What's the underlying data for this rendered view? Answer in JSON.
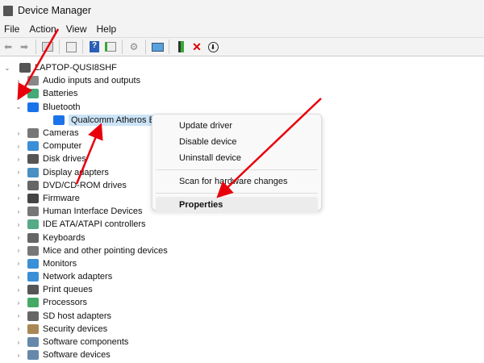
{
  "window": {
    "title": "Device Manager"
  },
  "menu": [
    "File",
    "Action",
    "View",
    "Help"
  ],
  "toolbar": {
    "icons": [
      "back-icon",
      "forward-icon",
      "show-hide-console-tree-icon",
      "properties-icon",
      "help-icon",
      "run-icon",
      "update-driver-icon",
      "scan-hardware-icon",
      "add-legacy-icon",
      "uninstall-icon",
      "disable-icon"
    ]
  },
  "tree": {
    "root": "LAPTOP-QUSI8SHF",
    "items": [
      {
        "label": "Audio inputs and outputs",
        "color": "#888"
      },
      {
        "label": "Batteries",
        "color": "#4a7"
      },
      {
        "label": "Bluetooth",
        "color": "#1a73e8",
        "expanded": true
      },
      {
        "label": "Qualcomm Atheros Bluet",
        "color": "#1a73e8",
        "child": true,
        "selected": true
      },
      {
        "label": "Cameras",
        "color": "#777"
      },
      {
        "label": "Computer",
        "color": "#3b8fd6"
      },
      {
        "label": "Disk drives",
        "color": "#555"
      },
      {
        "label": "Display adapters",
        "color": "#4a90c2"
      },
      {
        "label": "DVD/CD-ROM drives",
        "color": "#666"
      },
      {
        "label": "Firmware",
        "color": "#444"
      },
      {
        "label": "Human Interface Devices",
        "color": "#777"
      },
      {
        "label": "IDE ATA/ATAPI controllers",
        "color": "#5a8"
      },
      {
        "label": "Keyboards",
        "color": "#666"
      },
      {
        "label": "Mice and other pointing devices",
        "color": "#777"
      },
      {
        "label": "Monitors",
        "color": "#3b8fd6"
      },
      {
        "label": "Network adapters",
        "color": "#3b8fd6"
      },
      {
        "label": "Print queues",
        "color": "#555"
      },
      {
        "label": "Processors",
        "color": "#4a6"
      },
      {
        "label": "SD host adapters",
        "color": "#666"
      },
      {
        "label": "Security devices",
        "color": "#a85"
      },
      {
        "label": "Software components",
        "color": "#68a"
      },
      {
        "label": "Software devices",
        "color": "#68a"
      }
    ]
  },
  "context_menu": {
    "items": [
      "Update driver",
      "Disable device",
      "Uninstall device",
      "Scan for hardware changes",
      "Properties"
    ]
  },
  "annotation_color": "#e8000b"
}
